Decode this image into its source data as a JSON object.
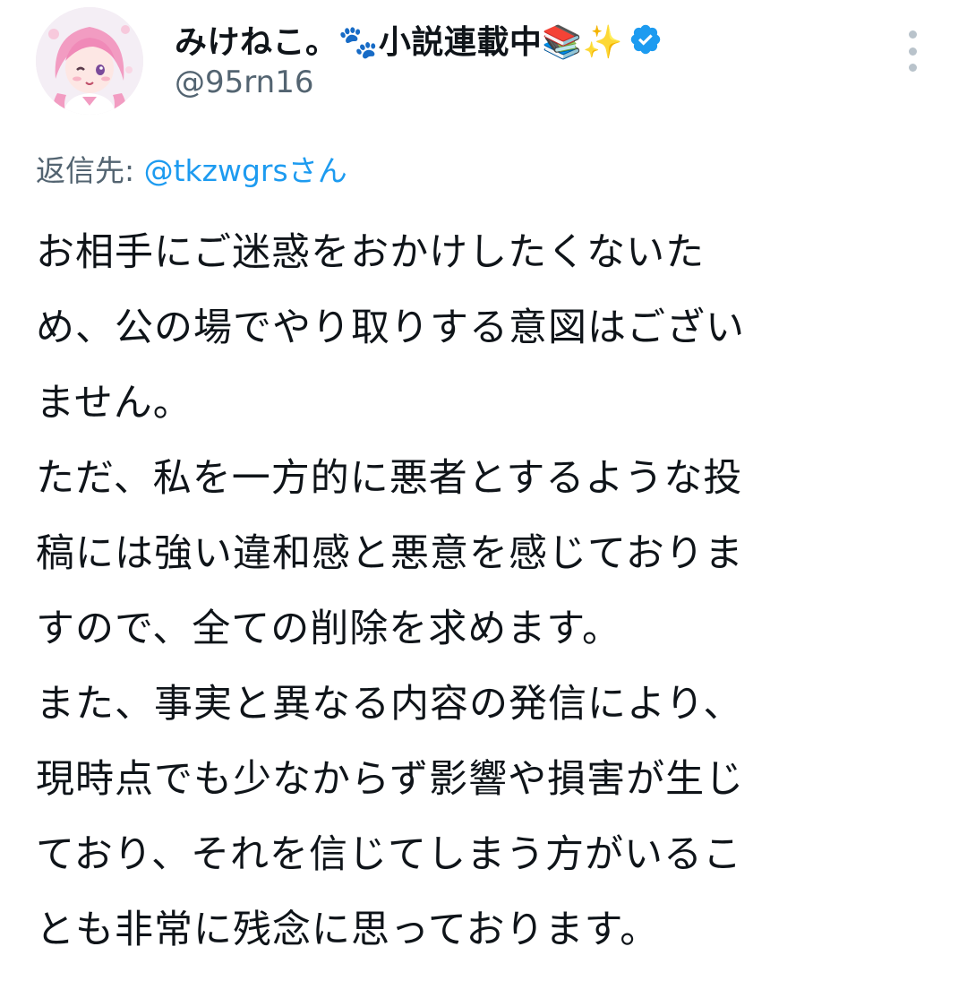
{
  "user": {
    "display_name": "みけねこ。🐾小説連載中📚✨",
    "handle": "@95rn16",
    "verified_color": "#1d9bf0",
    "avatar_icon": "anime-avatar"
  },
  "reply": {
    "prefix": "返信先: ",
    "mention": "@tkzwgrs",
    "suffix": "さん"
  },
  "tweet": {
    "lines": [
      "お相手にご迷惑をおかけしたくないた",
      "め、公の場でやり取りする意図はござい",
      "ません。",
      "ただ、私を一方的に悪者とするような投",
      "稿には強い違和感と悪意を感じておりま",
      "すので、全ての削除を求めます。",
      "また、事実と異なる内容の発信により、",
      "現時点でも少なからず影響や損害が生じ",
      "ており、それを信じてしまう方がいるこ",
      "とも非常に残念に思っております。"
    ]
  },
  "colors": {
    "text": "#0f1419",
    "secondary": "#536471",
    "link": "#1d9bf0"
  }
}
